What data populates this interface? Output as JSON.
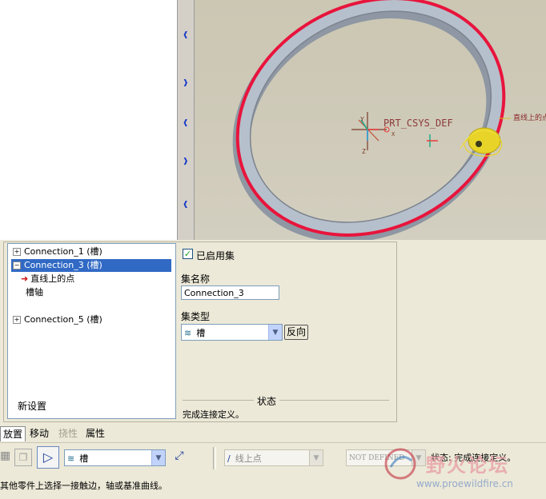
{
  "viewport": {
    "csys_label": "PRT_CSYS_DEF",
    "axis_x": "X",
    "axis_y": "Y",
    "axis_z": "Z",
    "point_label": "直线上的点"
  },
  "connections": {
    "items": [
      {
        "label": "Connection_1 (槽)",
        "expanded": false,
        "selected": false
      },
      {
        "label": "Connection_3 (槽)",
        "expanded": true,
        "selected": true,
        "children": [
          {
            "label": "直线上的点",
            "icon": "red-arrow-icon"
          },
          {
            "label": "槽轴"
          }
        ]
      },
      {
        "label": "Connection_5 (槽)",
        "expanded": false,
        "selected": false
      }
    ],
    "new_set_label": "新设置"
  },
  "props": {
    "enable_set_label": "已启用集",
    "enable_set_checked": true,
    "set_name_label": "集名称",
    "set_name_value": "Connection_3",
    "set_type_label": "集类型",
    "set_type_value": "槽",
    "reverse_label": "反向",
    "status_heading": "状态",
    "status_text": "完成连接定义。"
  },
  "tabs": [
    {
      "label": "放置",
      "active": true,
      "enabled": true
    },
    {
      "label": "移动",
      "active": false,
      "enabled": true
    },
    {
      "label": "挠性",
      "active": false,
      "enabled": false
    },
    {
      "label": "属性",
      "active": false,
      "enabled": true
    }
  ],
  "toolbar": {
    "type_value": "槽",
    "constraint_value": "线上点",
    "offset_value": "NOT DEFINED",
    "status_text": "状态: 完成连接定义。"
  },
  "statusbar": {
    "message": "其他零件上选择一接触边，轴或基准曲线。"
  },
  "watermark": {
    "title": "野火论坛",
    "url": "www.proewildfire.cn"
  },
  "colors": {
    "selection": "#316ac5",
    "ring_edge": "#e8143c",
    "ring_body": "#a8b4c2",
    "accent_blue": "#1a3cc8"
  }
}
